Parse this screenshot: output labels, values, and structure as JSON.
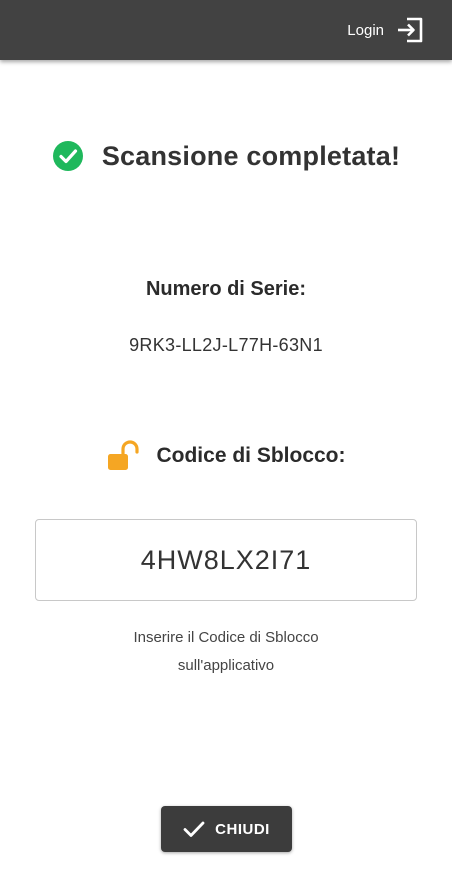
{
  "header": {
    "login_label": "Login",
    "login_icon": "login-icon",
    "background_color": "#424242"
  },
  "status": {
    "icon": "check-circle-icon",
    "icon_color": "#1fb85c",
    "title": "Scansione completata!"
  },
  "serial": {
    "label": "Numero di Serie:",
    "value": "9RK3-LL2J-L77H-63N1"
  },
  "unlock": {
    "icon": "unlock-icon",
    "icon_color": "#f5a623",
    "label": "Codice di Sblocco:",
    "code": "4HW8LX2I71",
    "hint_line1": "Inserire il Codice di Sblocco",
    "hint_line2": "sull'applicativo"
  },
  "footer": {
    "close_label": "CHIUDI",
    "close_icon": "check-icon"
  }
}
